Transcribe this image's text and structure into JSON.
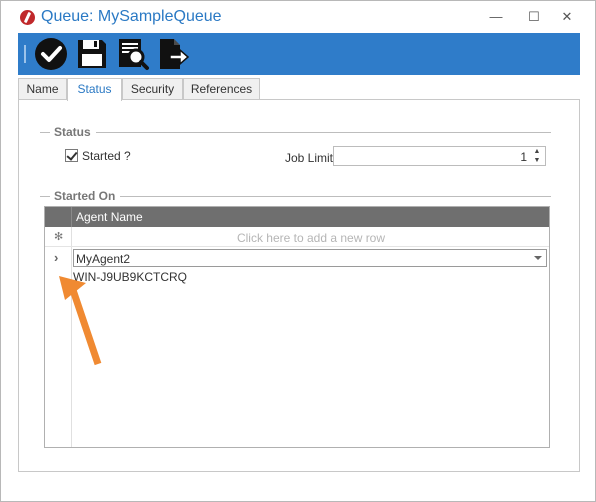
{
  "window": {
    "title": "Queue: MySampleQueue",
    "controls": {
      "minimize": "—",
      "maximize": "☐",
      "close": "✕"
    }
  },
  "toolbar": {
    "accent_color": "#2f7cc9",
    "buttons": [
      {
        "icon": "check-circle-icon"
      },
      {
        "icon": "save-icon"
      },
      {
        "icon": "document-preview-icon"
      },
      {
        "icon": "export-icon"
      }
    ]
  },
  "tabs": {
    "items": [
      "Name",
      "Status",
      "Security",
      "References"
    ],
    "active": "Status"
  },
  "status_group": {
    "header": "Status",
    "started_label": "Started ?",
    "started_checked": true,
    "job_limit_label": "Job Limit",
    "job_limit_value": "1"
  },
  "started_on_group": {
    "header": "Started On",
    "grid": {
      "column_header": "Agent Name",
      "new_row_marker": "✻",
      "new_row_hint": "Click here to add a new row",
      "current_row_marker": "›",
      "selected_value": "MyAgent2",
      "dropdown_options": [
        "WIN-J9UB9KCTCRQ"
      ]
    }
  },
  "annotation": {
    "color": "#f08a32"
  }
}
